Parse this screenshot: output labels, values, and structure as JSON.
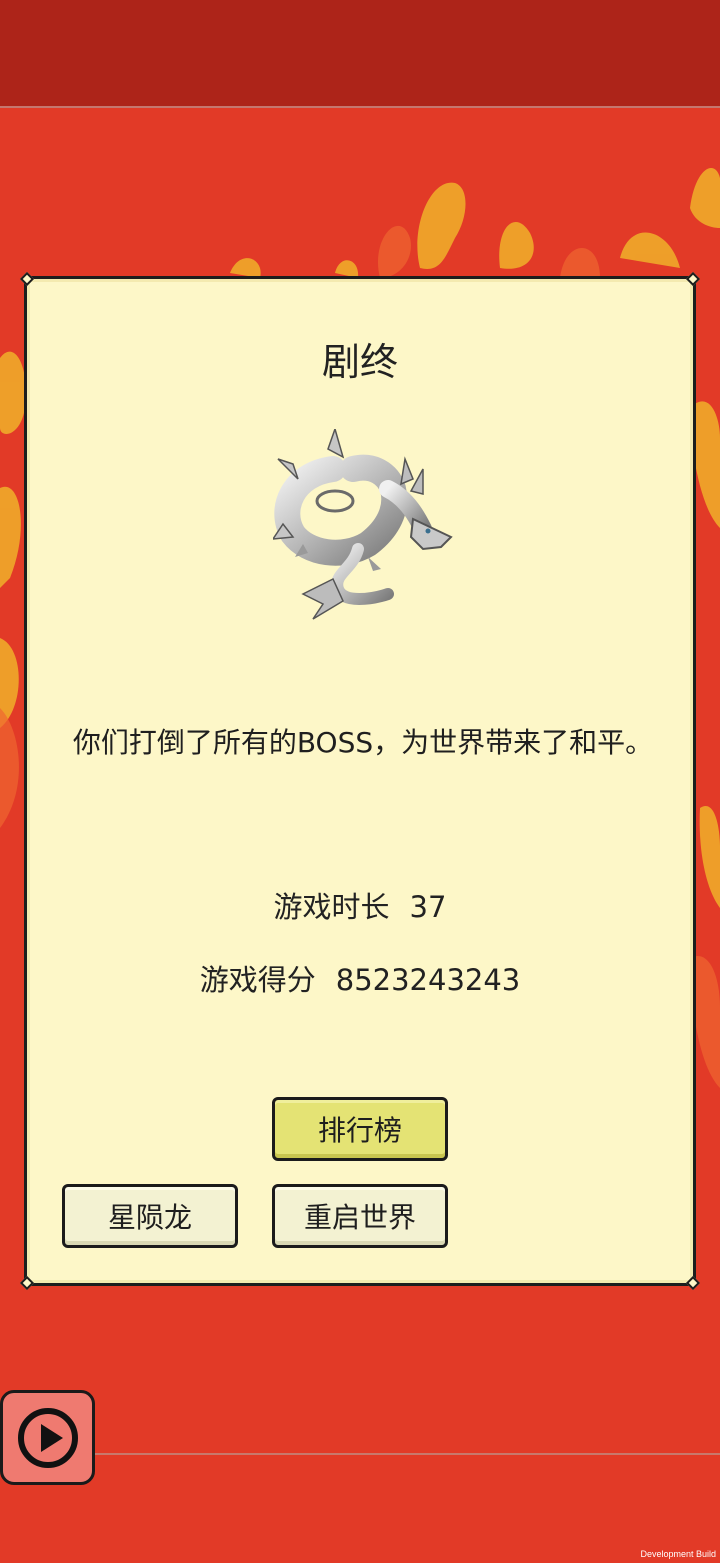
{
  "dialog": {
    "title": "剧终",
    "message": "你们打倒了所有的BOSS，为世界带来了和平。",
    "stats": [
      {
        "label": "游戏时长",
        "value": "37"
      },
      {
        "label": "游戏得分",
        "value": "8523243243"
      }
    ],
    "buttons": {
      "leaderboard": "排行榜",
      "boss_name": "星陨龙",
      "restart": "重启世界"
    }
  },
  "footer": {
    "build_label": "Development Build"
  },
  "icons": {
    "play": "play-icon",
    "dragon": "dragon-icon"
  },
  "colors": {
    "background": "#e23a27",
    "top_bar": "#ad2419",
    "panel": "#fdf7c8",
    "leaderboard_button": "#e4e374"
  }
}
